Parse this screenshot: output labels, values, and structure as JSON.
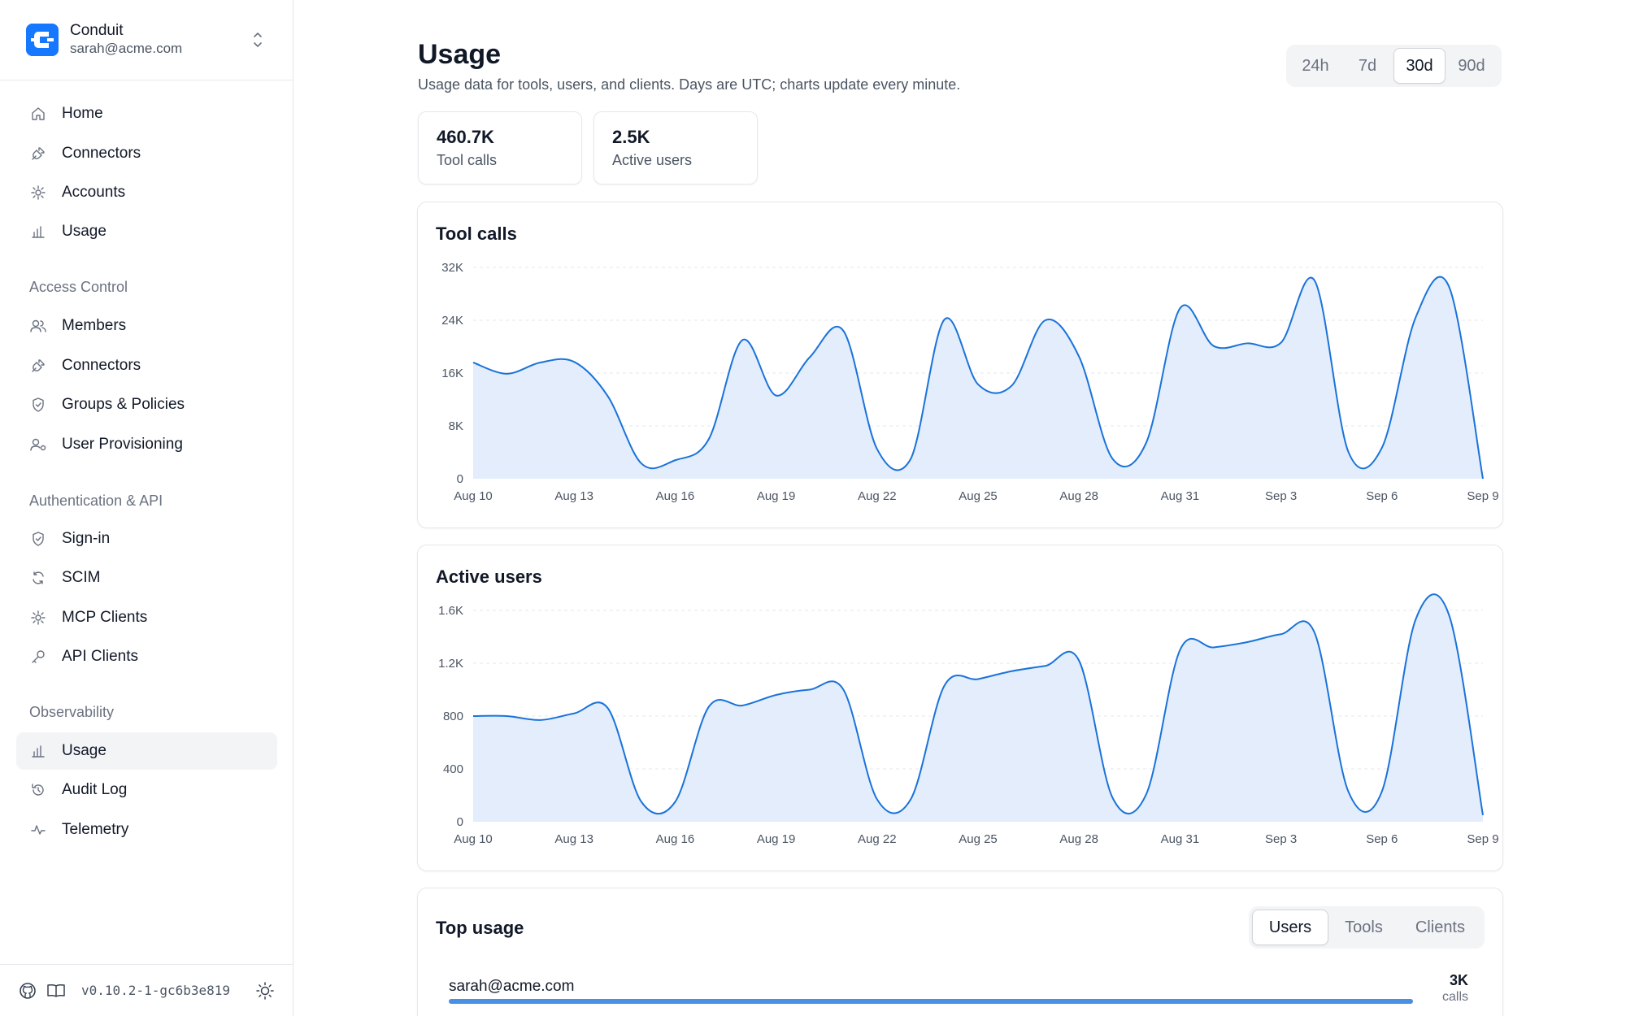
{
  "org": {
    "name": "Conduit",
    "email": "sarah@acme.com"
  },
  "nav": {
    "top": [
      {
        "label": "Home",
        "icon": "home-icon"
      },
      {
        "label": "Connectors",
        "icon": "plug-icon"
      },
      {
        "label": "Accounts",
        "icon": "plug-icon"
      },
      {
        "label": "Usage",
        "icon": "bar-chart-icon"
      }
    ],
    "sections": [
      {
        "title": "Access Control",
        "items": [
          {
            "label": "Members",
            "icon": "users-icon"
          },
          {
            "label": "Connectors",
            "icon": "plug-icon"
          },
          {
            "label": "Groups & Policies",
            "icon": "shield-icon"
          },
          {
            "label": "User Provisioning",
            "icon": "user-sync-icon"
          }
        ]
      },
      {
        "title": "Authentication & API",
        "items": [
          {
            "label": "Sign-in",
            "icon": "shield-icon"
          },
          {
            "label": "SCIM",
            "icon": "refresh-icon"
          },
          {
            "label": "MCP Clients",
            "icon": "plug-icon"
          },
          {
            "label": "API Clients",
            "icon": "key-icon"
          }
        ]
      },
      {
        "title": "Observability",
        "items": [
          {
            "label": "Usage",
            "icon": "bar-chart-icon",
            "active": true
          },
          {
            "label": "Audit Log",
            "icon": "history-icon"
          },
          {
            "label": "Telemetry",
            "icon": "activity-icon"
          }
        ]
      }
    ]
  },
  "footer": {
    "version": "v0.10.2-1-gc6b3e819"
  },
  "page": {
    "title": "Usage",
    "subtitle": "Usage data for tools, users, and clients. Days are UTC; charts update every minute."
  },
  "range": {
    "options": [
      "24h",
      "7d",
      "30d",
      "90d"
    ],
    "selected": "30d"
  },
  "stats": [
    {
      "value": "460.7K",
      "label": "Tool calls"
    },
    {
      "value": "2.5K",
      "label": "Active users"
    }
  ],
  "colors": {
    "accent": "#1677ff",
    "line": "#1a73d9",
    "area": "#e3edfc",
    "bar": "#4a90e2"
  },
  "chart_data": [
    {
      "type": "area",
      "title": "Tool calls",
      "x": [
        "Aug 10",
        "Aug 11",
        "Aug 12",
        "Aug 13",
        "Aug 14",
        "Aug 15",
        "Aug 16",
        "Aug 17",
        "Aug 18",
        "Aug 19",
        "Aug 20",
        "Aug 21",
        "Aug 22",
        "Aug 23",
        "Aug 24",
        "Aug 25",
        "Aug 26",
        "Aug 27",
        "Aug 28",
        "Aug 29",
        "Aug 30",
        "Aug 31",
        "Sep 1",
        "Sep 2",
        "Sep 3",
        "Sep 4",
        "Sep 5",
        "Sep 6",
        "Sep 7",
        "Sep 8",
        "Sep 9"
      ],
      "values": [
        17600,
        15900,
        17600,
        17700,
        12500,
        2300,
        2800,
        6000,
        21000,
        12600,
        18400,
        22400,
        4500,
        3000,
        24100,
        14300,
        14100,
        24000,
        18500,
        3000,
        5500,
        25800,
        20100,
        20500,
        20600,
        30000,
        4100,
        4700,
        24400,
        29000,
        0
      ],
      "xticks": [
        "Aug 10",
        "Aug 13",
        "Aug 16",
        "Aug 19",
        "Aug 22",
        "Aug 25",
        "Aug 28",
        "Aug 31",
        "Sep 3",
        "Sep 6",
        "Sep 9"
      ],
      "yticks": [
        "0",
        "8K",
        "16K",
        "24K",
        "32K"
      ],
      "ylim": [
        0,
        32000
      ],
      "grid": true
    },
    {
      "type": "area",
      "title": "Active users",
      "x": [
        "Aug 10",
        "Aug 11",
        "Aug 12",
        "Aug 13",
        "Aug 14",
        "Aug 15",
        "Aug 16",
        "Aug 17",
        "Aug 18",
        "Aug 19",
        "Aug 20",
        "Aug 21",
        "Aug 22",
        "Aug 23",
        "Aug 24",
        "Aug 25",
        "Aug 26",
        "Aug 27",
        "Aug 28",
        "Aug 29",
        "Aug 30",
        "Aug 31",
        "Sep 1",
        "Sep 2",
        "Sep 3",
        "Sep 4",
        "Sep 5",
        "Sep 6",
        "Sep 7",
        "Sep 8",
        "Sep 9"
      ],
      "values": [
        800,
        800,
        770,
        820,
        860,
        150,
        150,
        870,
        880,
        960,
        1000,
        1000,
        170,
        170,
        1030,
        1080,
        1140,
        1180,
        1220,
        180,
        210,
        1300,
        1320,
        1360,
        1420,
        1430,
        230,
        230,
        1530,
        1560,
        50
      ],
      "xticks": [
        "Aug 10",
        "Aug 13",
        "Aug 16",
        "Aug 19",
        "Aug 22",
        "Aug 25",
        "Aug 28",
        "Aug 31",
        "Sep 3",
        "Sep 6",
        "Sep 9"
      ],
      "yticks": [
        "0",
        "400",
        "800",
        "1.2K",
        "1.6K"
      ],
      "ylim": [
        0,
        1600
      ],
      "grid": true
    }
  ],
  "top_usage": {
    "title": "Top usage",
    "tabs": [
      "Users",
      "Tools",
      "Clients"
    ],
    "selected": "Users",
    "rows": [
      {
        "name": "sarah@acme.com",
        "count": "3K",
        "unit": "calls",
        "share": 1.0
      }
    ]
  }
}
